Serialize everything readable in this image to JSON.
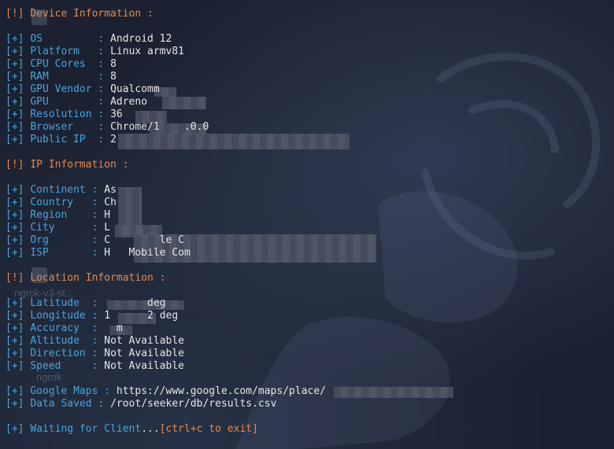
{
  "device": {
    "header": "Device Information :",
    "rows": [
      {
        "label": "OS",
        "value": "Android 12"
      },
      {
        "label": "Platform",
        "value": "Linux armv81"
      },
      {
        "label": "CPU Cores",
        "value": "8"
      },
      {
        "label": "RAM",
        "value": "8"
      },
      {
        "label": "GPU Vendor",
        "value": "Qualcomm"
      },
      {
        "label": "GPU",
        "value": "Adreno"
      },
      {
        "label": "Resolution",
        "value": "36"
      },
      {
        "label": "Browser",
        "value": "Chrome/1    .0.0"
      },
      {
        "label": "Public IP",
        "value": "2"
      }
    ]
  },
  "ip": {
    "header": "IP Information :",
    "rows": [
      {
        "label": "Continent",
        "value": "As"
      },
      {
        "label": "Country",
        "value": "Ch"
      },
      {
        "label": "Region",
        "value": "H"
      },
      {
        "label": "City",
        "value": "L"
      },
      {
        "label": "Org",
        "value": "C        le C"
      },
      {
        "label": "ISP",
        "value": "H   Mobile Com"
      }
    ]
  },
  "location": {
    "header": "Location Information :",
    "rows": [
      {
        "label": "Latitude",
        "value": "       deg"
      },
      {
        "label": "Longitude",
        "value": "1      2 deg"
      },
      {
        "label": "Accuracy",
        "value": "  m"
      },
      {
        "label": "Altitude",
        "value": "Not Available"
      },
      {
        "label": "Direction",
        "value": "Not Available"
      },
      {
        "label": "Speed",
        "value": "Not Available"
      }
    ]
  },
  "output": {
    "rows": [
      {
        "label": "Google Maps",
        "value": "https://www.google.com/maps/place/"
      },
      {
        "label": "Data Saved",
        "value": "/root/seeker/db/results.csv"
      }
    ]
  },
  "status": {
    "waiting": "Waiting for Client",
    "dots": "...",
    "exit_hint": "[ctrl+c to exit]"
  },
  "markers": {
    "warn": "[!]",
    "ok": "[+]"
  },
  "desktop": {
    "ghost_label_1": "ngrok-v3-st...",
    "ghost_label_2": "ngrok"
  },
  "colors": {
    "background": "#1b2130",
    "accent_orange": "#e6894a",
    "accent_blue": "#4aa3df",
    "text": "#e6e6e6"
  }
}
